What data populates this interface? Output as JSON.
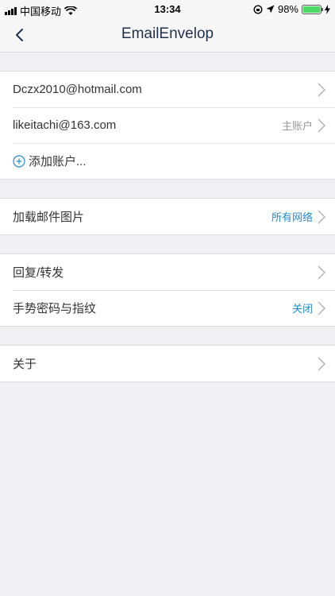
{
  "status_bar": {
    "carrier": "中国移动",
    "time": "13:34",
    "battery_percent": "98%",
    "battery_level": 0.98,
    "icons": [
      "signal-icon",
      "wifi-icon",
      "rotation-lock-icon",
      "location-icon",
      "battery-icon",
      "charging-icon"
    ]
  },
  "nav": {
    "title": "EmailEnvelop",
    "back_icon": "chevron-left-icon"
  },
  "accounts": [
    {
      "email": "Dczx2010@hotmail.com",
      "detail": ""
    },
    {
      "email": "likeitachi@163.com",
      "detail": "主账户"
    }
  ],
  "add_account_label": "添加账户...",
  "images": {
    "label": "加载邮件图片",
    "value": "所有网络"
  },
  "settings": [
    {
      "label": "回复/转发",
      "value": ""
    },
    {
      "label": "手势密码与指纹",
      "value": "关闭"
    }
  ],
  "about": {
    "label": "关于"
  },
  "colors": {
    "accent": "#1f8ad4",
    "title": "#1f3050",
    "background": "#f0f0f2",
    "battery": "#4cd964"
  }
}
